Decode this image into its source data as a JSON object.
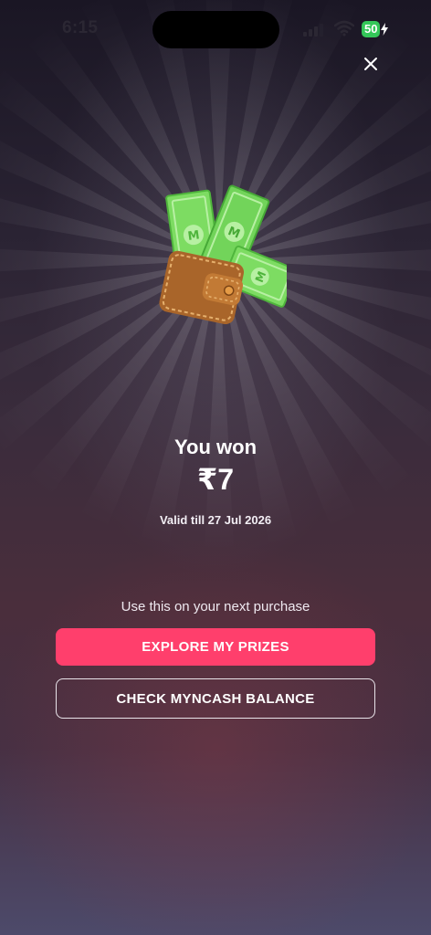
{
  "status_bar": {
    "time": "6:15",
    "battery_level": "50"
  },
  "reward": {
    "title": "You won",
    "amount": "₹7",
    "validity": "Valid till 27 Jul 2026"
  },
  "hint": "Use this on your next purchase",
  "actions": {
    "primary_label": "EXPLORE MY PRIZES",
    "secondary_label": "CHECK MYNCASH BALANCE"
  },
  "icons": {
    "close": "close-icon",
    "illustration": "wallet-money-icon",
    "signal": "cellular-signal-icon",
    "wifi": "wifi-icon",
    "battery": "battery-icon"
  },
  "colors": {
    "accent": "#ff3f6c",
    "battery": "#34c759",
    "cash": "#6fd25a",
    "wallet": "#b5702f"
  }
}
